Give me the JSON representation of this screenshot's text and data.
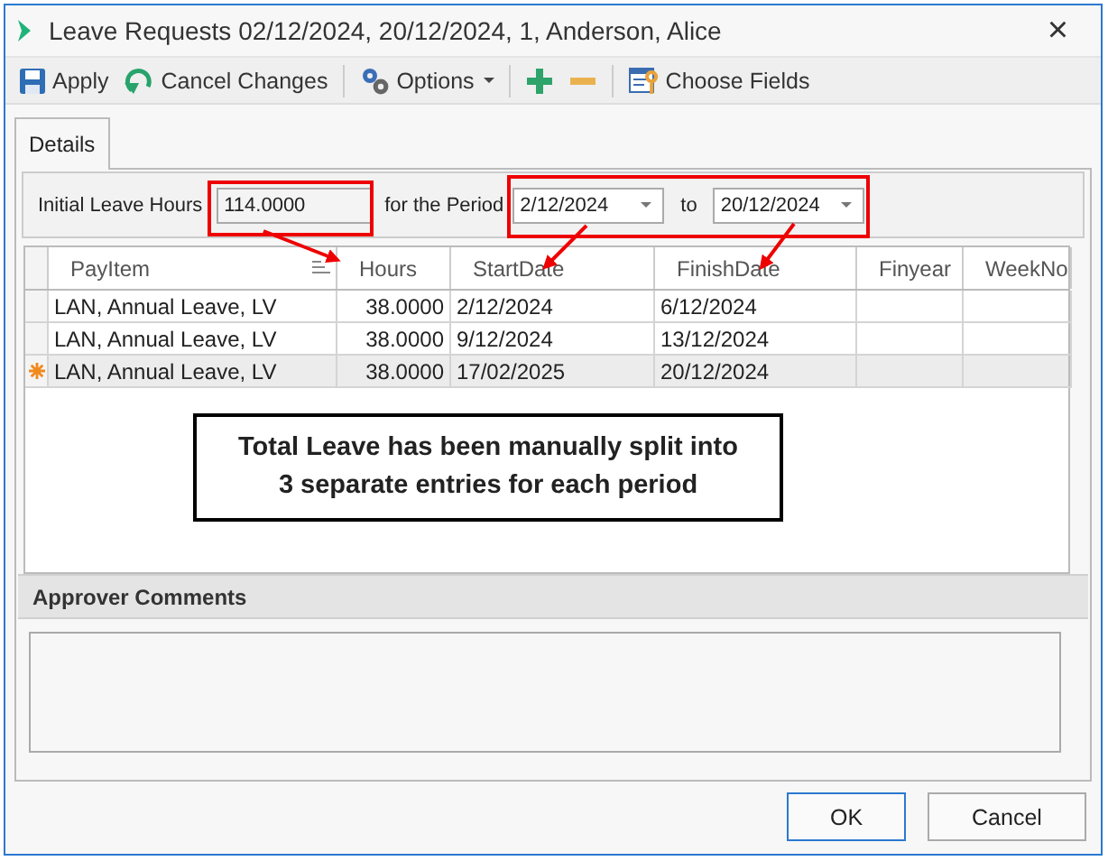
{
  "window": {
    "title": "Leave Requests 02/12/2024, 20/12/2024, 1, Anderson, Alice",
    "close": "×"
  },
  "toolbar": [
    {
      "kind": "save",
      "label": "Apply"
    },
    {
      "kind": "undo",
      "label": "Cancel Changes"
    },
    {
      "kind": "gears",
      "label": "Options",
      "dropdown": true
    },
    {
      "kind": "plus"
    },
    {
      "kind": "minus"
    },
    {
      "kind": "fields",
      "label": "Choose Fields"
    }
  ],
  "tabs": [
    {
      "label": "Details",
      "selected": true
    }
  ],
  "filter": {
    "hours_label": "Initial Leave Hours",
    "hours_value": "114.0000",
    "period_label": "for the Period",
    "from": "2/12/2024",
    "to_label": "to",
    "to": "20/12/2024"
  },
  "table": {
    "columns": [
      "PayItem",
      "Hours",
      "StartDate",
      "FinishDate",
      "Finyear",
      "WeekNo"
    ],
    "rows": [
      {
        "cells": [
          "LAN, Annual Leave, LV",
          "38.0000",
          "2/12/2024",
          "6/12/2024",
          "",
          ""
        ],
        "selected": false,
        "new_row": false
      },
      {
        "cells": [
          "LAN, Annual Leave, LV",
          "38.0000",
          "9/12/2024",
          "13/12/2024",
          "",
          ""
        ],
        "selected": false,
        "new_row": false
      },
      {
        "cells": [
          "LAN, Annual Leave, LV",
          "38.0000",
          "17/02/2025",
          "20/12/2024",
          "",
          ""
        ],
        "selected": true,
        "new_row": true
      }
    ]
  },
  "approver_comments": {
    "title": "Approver Comments"
  },
  "buttons": [
    {
      "label": "OK",
      "default": true
    },
    {
      "label": "Cancel",
      "default": false
    }
  ],
  "annotation": {
    "callout": "Total Leave has been manually split into 3 separate entries for each period"
  }
}
